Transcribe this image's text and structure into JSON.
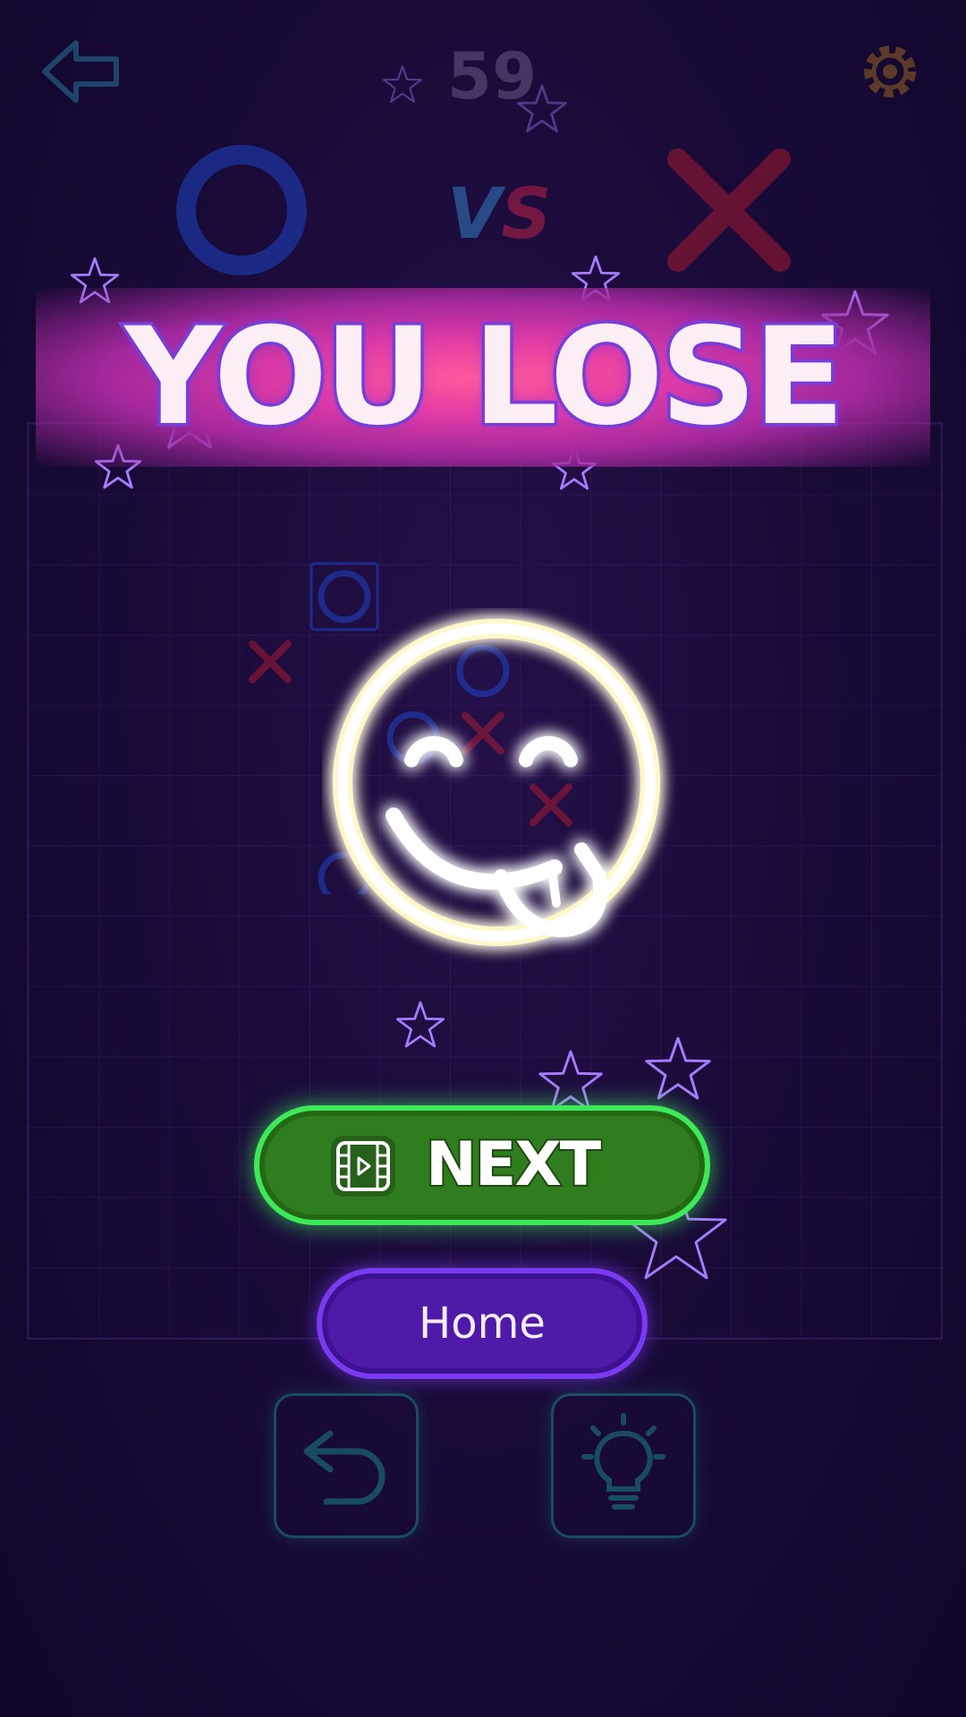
{
  "header": {
    "timer": "59",
    "vs_left": "V",
    "vs_right": "S"
  },
  "result": {
    "title": "YOU LOSE"
  },
  "buttons": {
    "next_label": "NEXT",
    "home_label": "Home"
  },
  "icons": {
    "back": "back-arrow-icon",
    "settings": "gear-icon",
    "player_o": "o-ring-icon",
    "player_x": "x-cross-icon",
    "smiley": "tongue-smiley-icon",
    "video": "video-ad-icon",
    "undo": "undo-icon",
    "hint": "lightbulb-icon",
    "decor": "star-icon"
  },
  "colors": {
    "banner": "#e23ca6",
    "next_button": "#2f7d1e",
    "home_button": "#4f1aa8",
    "player_o": "#1e5bff",
    "player_x": "#e0202e"
  }
}
